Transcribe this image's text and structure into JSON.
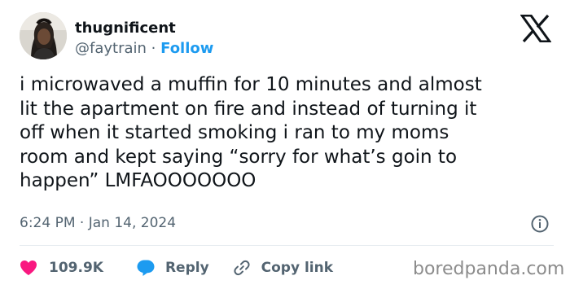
{
  "author": {
    "display_name": "thugnificent",
    "handle": "@faytrain",
    "separator": "·",
    "follow_label": "Follow"
  },
  "tweet": {
    "text": "i microwaved a muffin for 10 minutes and almost\nlit the apartment on fire and instead of turning it\noff when it started smoking i ran to my moms\nroom and kept saying “sorry for what’s goin to\nhappen” LMFAOOOOOOO",
    "timestamp": "6:24 PM · Jan 14, 2024"
  },
  "actions": {
    "like_count": "109.9K",
    "reply_label": "Reply",
    "copy_link_label": "Copy link"
  },
  "watermark": "boredpanda.com",
  "icons": {
    "platform": "x-logo-icon",
    "info": "info-icon",
    "like": "heart-icon",
    "reply": "reply-bubble-icon",
    "copy": "link-icon"
  },
  "colors": {
    "like": "#f91880",
    "reply": "#1d9bf0",
    "follow": "#1d9bf0",
    "secondary_text": "#536471",
    "primary_text": "#0f1419"
  }
}
